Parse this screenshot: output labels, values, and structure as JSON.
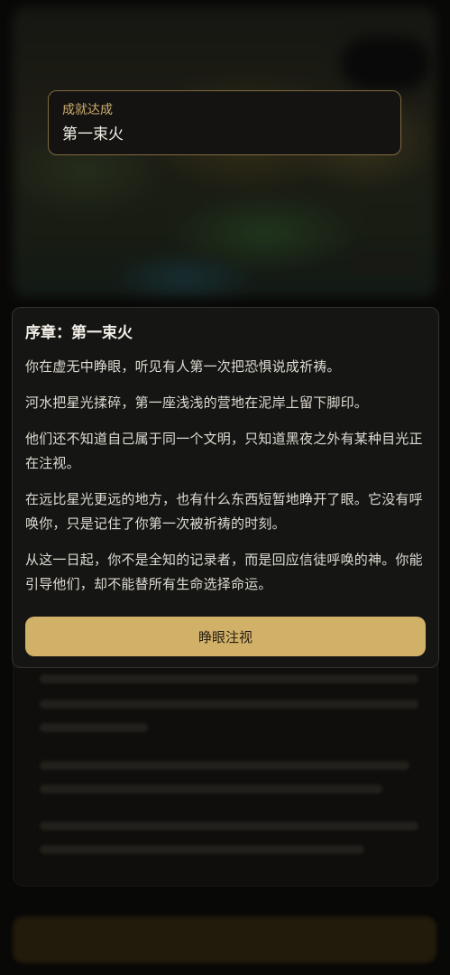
{
  "achievement": {
    "label": "成就达成",
    "title": "第一束火"
  },
  "story": {
    "title": "序章：第一束火",
    "paragraphs": [
      "你在虚无中睁眼，听见有人第一次把恐惧说成祈祷。",
      "河水把星光揉碎，第一座浅浅的营地在泥岸上留下脚印。",
      "他们还不知道自己属于同一个文明，只知道黑夜之外有某种目光正在注视。",
      "在远比星光更远的地方，也有什么东西短暂地睁开了眼。它没有呼唤你，只是记住了你第一次被祈祷的时刻。",
      "从这一日起，你不是全知的记录者，而是回应信徒呼唤的神。你能引导他们，却不能替所有生命选择命运。"
    ],
    "button_label": "睁眼注视"
  },
  "colors": {
    "accent_gold": "#d1b068",
    "toast_label": "#cfae6d",
    "dialog_bg": "#151513"
  }
}
